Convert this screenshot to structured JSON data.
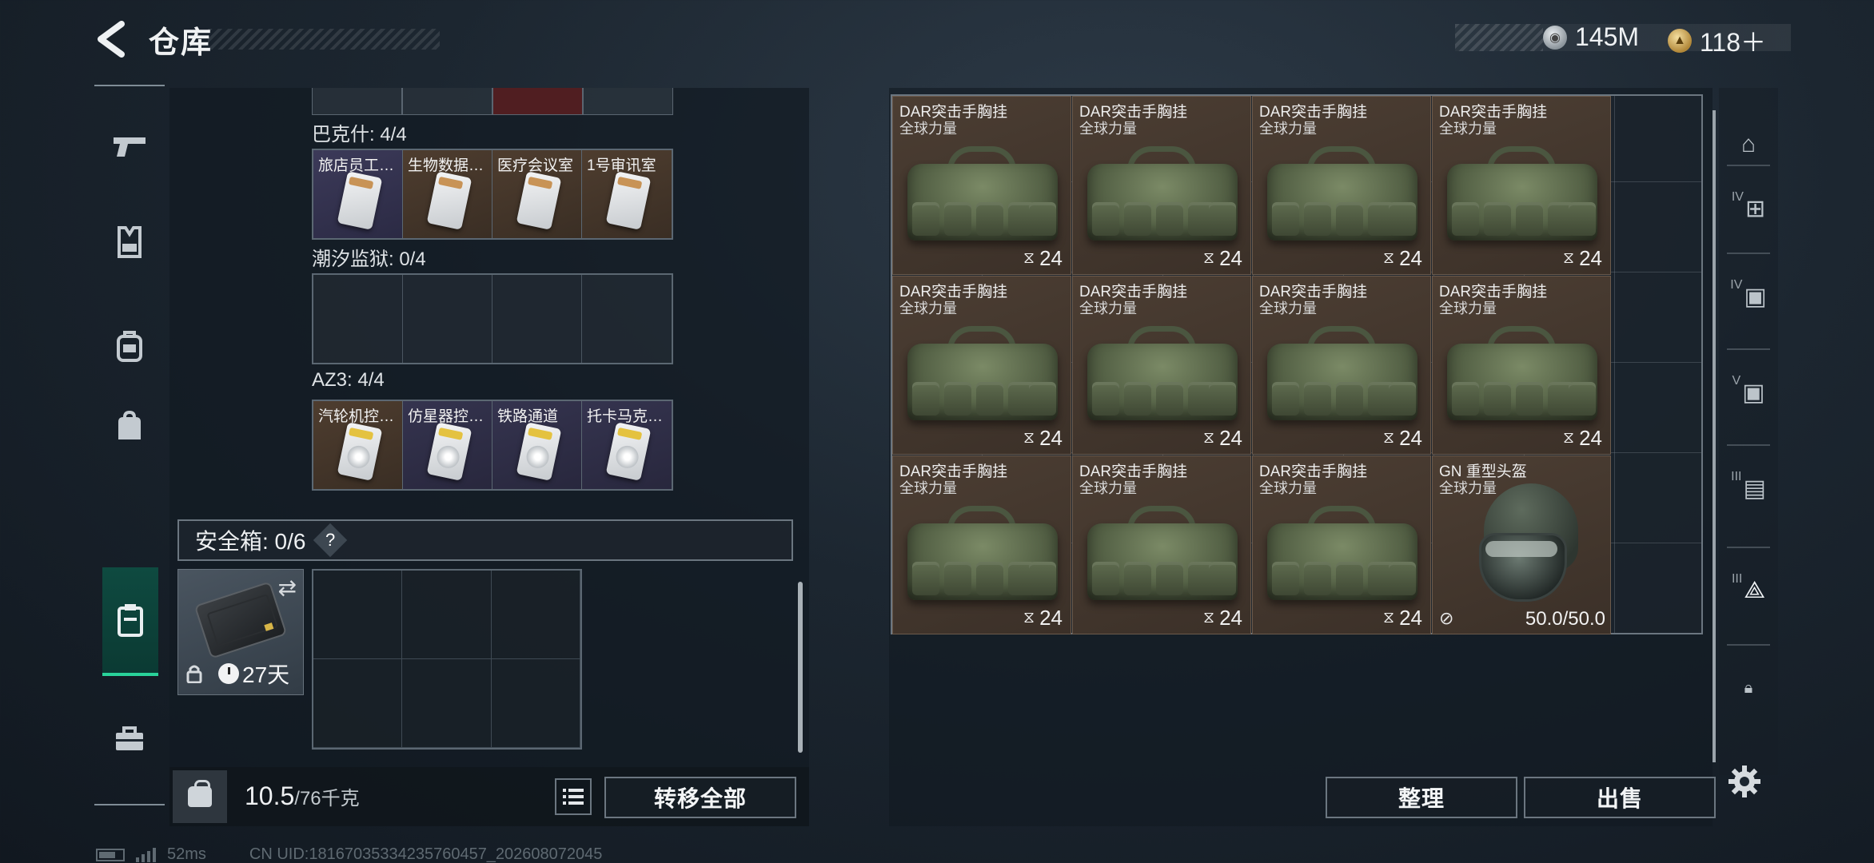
{
  "header": {
    "title": "仓库",
    "back_icon": "back-arrow-icon",
    "currency": [
      {
        "icon": "silver-coin-icon",
        "value": "145M"
      },
      {
        "icon": "gold-coin-icon",
        "value": "118＋"
      }
    ]
  },
  "left_nav": {
    "items": [
      {
        "name": "weapon",
        "icon": "pistol-icon"
      },
      {
        "name": "vest",
        "icon": "vest-icon"
      },
      {
        "name": "backpack",
        "icon": "backpack-icon"
      },
      {
        "name": "bag",
        "icon": "bag-icon"
      },
      {
        "name": "case",
        "icon": "case-icon",
        "active": true
      },
      {
        "name": "toolbox",
        "icon": "toolbox-icon"
      }
    ]
  },
  "keys": {
    "groups": [
      {
        "label": "巴克什: 4/4",
        "items": [
          "旅店员工…",
          "生物数据…",
          "医疗会议室",
          "1号审讯室"
        ],
        "style": "card"
      },
      {
        "label": "潮汐监狱: 0/4",
        "items": [],
        "style": "empty"
      },
      {
        "label": "AZ3: 4/4",
        "items": [
          "汽轮机控…",
          "仿星器控…",
          "铁路通道",
          "托卡马克…"
        ],
        "style": "disc"
      }
    ]
  },
  "safe": {
    "label": "安全箱: 0/6",
    "help": "?",
    "timer": "27天"
  },
  "weight": {
    "current": "10.5",
    "max": "/76千克"
  },
  "buttons": {
    "transfer_all": "转移全部",
    "sort": "整理",
    "sell": "出售"
  },
  "storage": {
    "items": [
      {
        "name": "DAR突击手胸挂",
        "sub": "全球力量",
        "count": "24",
        "type": "vest"
      },
      {
        "name": "DAR突击手胸挂",
        "sub": "全球力量",
        "count": "24",
        "type": "vest"
      },
      {
        "name": "DAR突击手胸挂",
        "sub": "全球力量",
        "count": "24",
        "type": "vest"
      },
      {
        "name": "DAR突击手胸挂",
        "sub": "全球力量",
        "count": "24",
        "type": "vest"
      },
      {
        "name": "DAR突击手胸挂",
        "sub": "全球力量",
        "count": "24",
        "type": "vest"
      },
      {
        "name": "DAR突击手胸挂",
        "sub": "全球力量",
        "count": "24",
        "type": "vest"
      },
      {
        "name": "DAR突击手胸挂",
        "sub": "全球力量",
        "count": "24",
        "type": "vest"
      },
      {
        "name": "DAR突击手胸挂",
        "sub": "全球力量",
        "count": "24",
        "type": "vest"
      },
      {
        "name": "DAR突击手胸挂",
        "sub": "全球力量",
        "count": "24",
        "type": "vest"
      },
      {
        "name": "DAR突击手胸挂",
        "sub": "全球力量",
        "count": "24",
        "type": "vest"
      },
      {
        "name": "DAR突击手胸挂",
        "sub": "全球力量",
        "count": "24",
        "type": "vest"
      },
      {
        "name": "GN 重型头盔",
        "sub": "全球力量",
        "durability": "50.0/50.0",
        "type": "helmet"
      }
    ]
  },
  "right_nav": {
    "items": [
      {
        "icon": "storage-home-icon",
        "roman": ""
      },
      {
        "icon": "add-storage-icon",
        "roman": "IV"
      },
      {
        "icon": "storage-settings-icon",
        "roman": "IV"
      },
      {
        "icon": "storage-settings-icon",
        "roman": "V"
      },
      {
        "icon": "workbench-icon",
        "roman": "III"
      },
      {
        "icon": "range-storage-icon",
        "roman": "III"
      },
      {
        "icon": "lock-icon",
        "roman": ""
      }
    ],
    "settings_icon": "gear-icon"
  },
  "status_bar": {
    "ping": "52ms",
    "uid": "CN UID:18167035334235760457_202608072045"
  }
}
